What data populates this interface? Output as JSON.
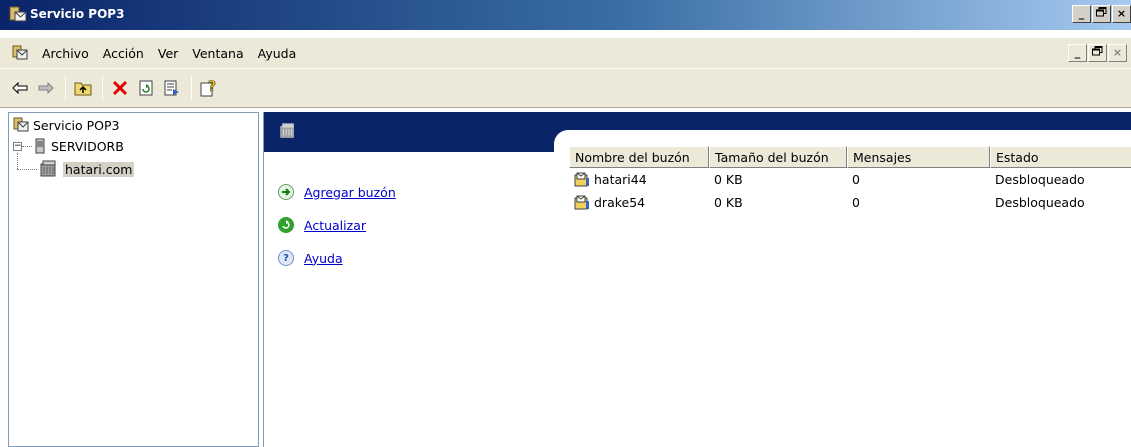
{
  "window": {
    "title": "Servicio POP3",
    "controls": [
      "_",
      "х",
      "×"
    ]
  },
  "menubar": {
    "items": [
      "Archivo",
      "Acción",
      "Ver",
      "Ventana",
      "Ayuda"
    ],
    "controls": [
      "_",
      "х",
      "×"
    ]
  },
  "toolbar": {
    "buttons": [
      "back-icon",
      "forward-icon",
      "up-folder-icon",
      "delete-icon",
      "properties-icon",
      "export-list-icon",
      "help-icon"
    ]
  },
  "tree": {
    "root": "Servicio POP3",
    "server": "SERVIDORB",
    "domain": "hatari.com"
  },
  "tasks": {
    "add": "Agregar buzón",
    "refresh": "Actualizar",
    "help": "Ayuda"
  },
  "table": {
    "headers": [
      "Nombre del buzón",
      "Tamaño del buzón",
      "Mensajes",
      "Estado"
    ],
    "rows": [
      [
        "hatari44",
        "0 KB",
        "0",
        "Desbloqueado"
      ],
      [
        "drake54",
        "0 KB",
        "0",
        "Desbloqueado"
      ]
    ]
  }
}
